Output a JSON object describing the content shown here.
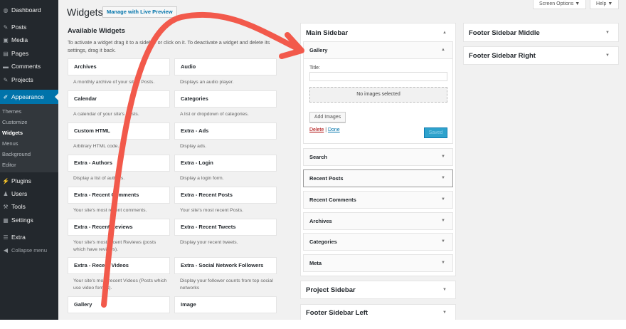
{
  "menu": {
    "items": [
      {
        "label": "Dashboard",
        "icon": "dashboard-icon",
        "glyph": "◍"
      },
      {
        "label": "Posts",
        "icon": "pin-icon",
        "glyph": "✎"
      },
      {
        "label": "Media",
        "icon": "media-icon",
        "glyph": "▣"
      },
      {
        "label": "Pages",
        "icon": "pages-icon",
        "glyph": "▤"
      },
      {
        "label": "Comments",
        "icon": "comment-icon",
        "glyph": "▬"
      },
      {
        "label": "Projects",
        "icon": "pin-icon",
        "glyph": "✎"
      },
      {
        "label": "Appearance",
        "icon": "brush-icon",
        "glyph": "✐",
        "current": true
      },
      {
        "label": "Plugins",
        "icon": "plugin-icon",
        "glyph": "⚡"
      },
      {
        "label": "Users",
        "icon": "users-icon",
        "glyph": "♟"
      },
      {
        "label": "Tools",
        "icon": "wrench-icon",
        "glyph": "⚒"
      },
      {
        "label": "Settings",
        "icon": "settings-icon",
        "glyph": "▦"
      },
      {
        "label": "Extra",
        "icon": "extra-icon",
        "glyph": "☰"
      }
    ],
    "submenu": [
      "Themes",
      "Customize",
      "Widgets",
      "Menus",
      "Background",
      "Editor"
    ],
    "current_sub": "Widgets",
    "collapse": "Collapse menu"
  },
  "header": {
    "title": "Widgets",
    "live_preview": "Manage with Live Preview",
    "screen_options": "Screen Options ▼",
    "help": "Help ▼"
  },
  "available": {
    "title": "Available Widgets",
    "intro": "To activate a widget drag it to a sidebar or click on it. To deactivate a widget and delete its settings, drag it back.",
    "widgets": [
      {
        "name": "Archives",
        "desc": "A monthly archive of your site's Posts."
      },
      {
        "name": "Audio",
        "desc": "Displays an audio player."
      },
      {
        "name": "Calendar",
        "desc": "A calendar of your site's Posts."
      },
      {
        "name": "Categories",
        "desc": "A list or dropdown of categories."
      },
      {
        "name": "Custom HTML",
        "desc": "Arbitrary HTML code."
      },
      {
        "name": "Extra - Ads",
        "desc": "Display ads."
      },
      {
        "name": "Extra - Authors",
        "desc": "Display a list of authors."
      },
      {
        "name": "Extra - Login",
        "desc": "Display a login form."
      },
      {
        "name": "Extra - Recent Comments",
        "desc": "Your site's most recent comments."
      },
      {
        "name": "Extra - Recent Posts",
        "desc": "Your site's most recent Posts."
      },
      {
        "name": "Extra - Recent Reviews",
        "desc": "Your site's most recent Reviews (posts which have reviews)."
      },
      {
        "name": "Extra - Recent Tweets",
        "desc": "Display your recent tweets."
      },
      {
        "name": "Extra - Recent Videos",
        "desc": "Your site's most recent Videos (Posts which use video format)."
      },
      {
        "name": "Extra - Social Network Followers",
        "desc": "Display your follower counts from top social networks"
      },
      {
        "name": "Gallery",
        "desc": ""
      },
      {
        "name": "Image",
        "desc": ""
      }
    ]
  },
  "main_sidebar": {
    "title": "Main Sidebar",
    "gallery": {
      "title": "Gallery",
      "title_label": "Title:",
      "title_value": "",
      "no_images": "No images selected",
      "add_images": "Add Images",
      "delete": "Delete",
      "sep": "|",
      "done": "Done",
      "saved": "Saved"
    },
    "widgets": [
      "Search",
      "Recent Posts",
      "Recent Comments",
      "Archives",
      "Categories",
      "Meta"
    ]
  },
  "sidebars": {
    "project": "Project Sidebar",
    "footer_left": "Footer Sidebar Left",
    "footer_middle": "Footer Sidebar Middle",
    "footer_right": "Footer Sidebar Right"
  },
  "colors": {
    "accent": "#0073aa",
    "annotation_arrow": "#f2594b"
  }
}
